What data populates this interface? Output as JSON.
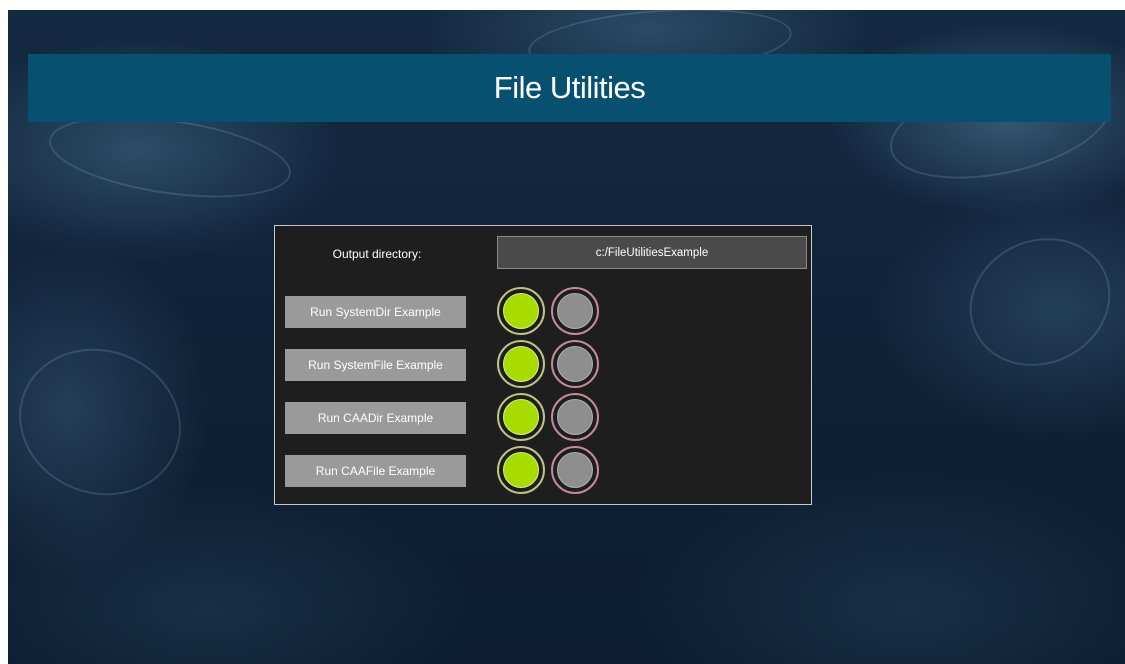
{
  "header": {
    "title": "File Utilities"
  },
  "output": {
    "label": "Output directory:",
    "value": "c:/FileUtilitiesExample"
  },
  "examples": [
    {
      "label": "Run SystemDir Example",
      "success": true,
      "error": false
    },
    {
      "label": "Run SystemFile Example",
      "success": true,
      "error": false
    },
    {
      "label": "Run CAADir Example",
      "success": true,
      "error": false
    },
    {
      "label": "Run CAAFile Example",
      "success": true,
      "error": false
    }
  ],
  "colors": {
    "header_bg": "#08506f",
    "panel_bg": "#1e1e1e",
    "button_bg": "#9a9a9a",
    "led_success": "#a8dc00",
    "led_idle": "#8e8e8e"
  }
}
